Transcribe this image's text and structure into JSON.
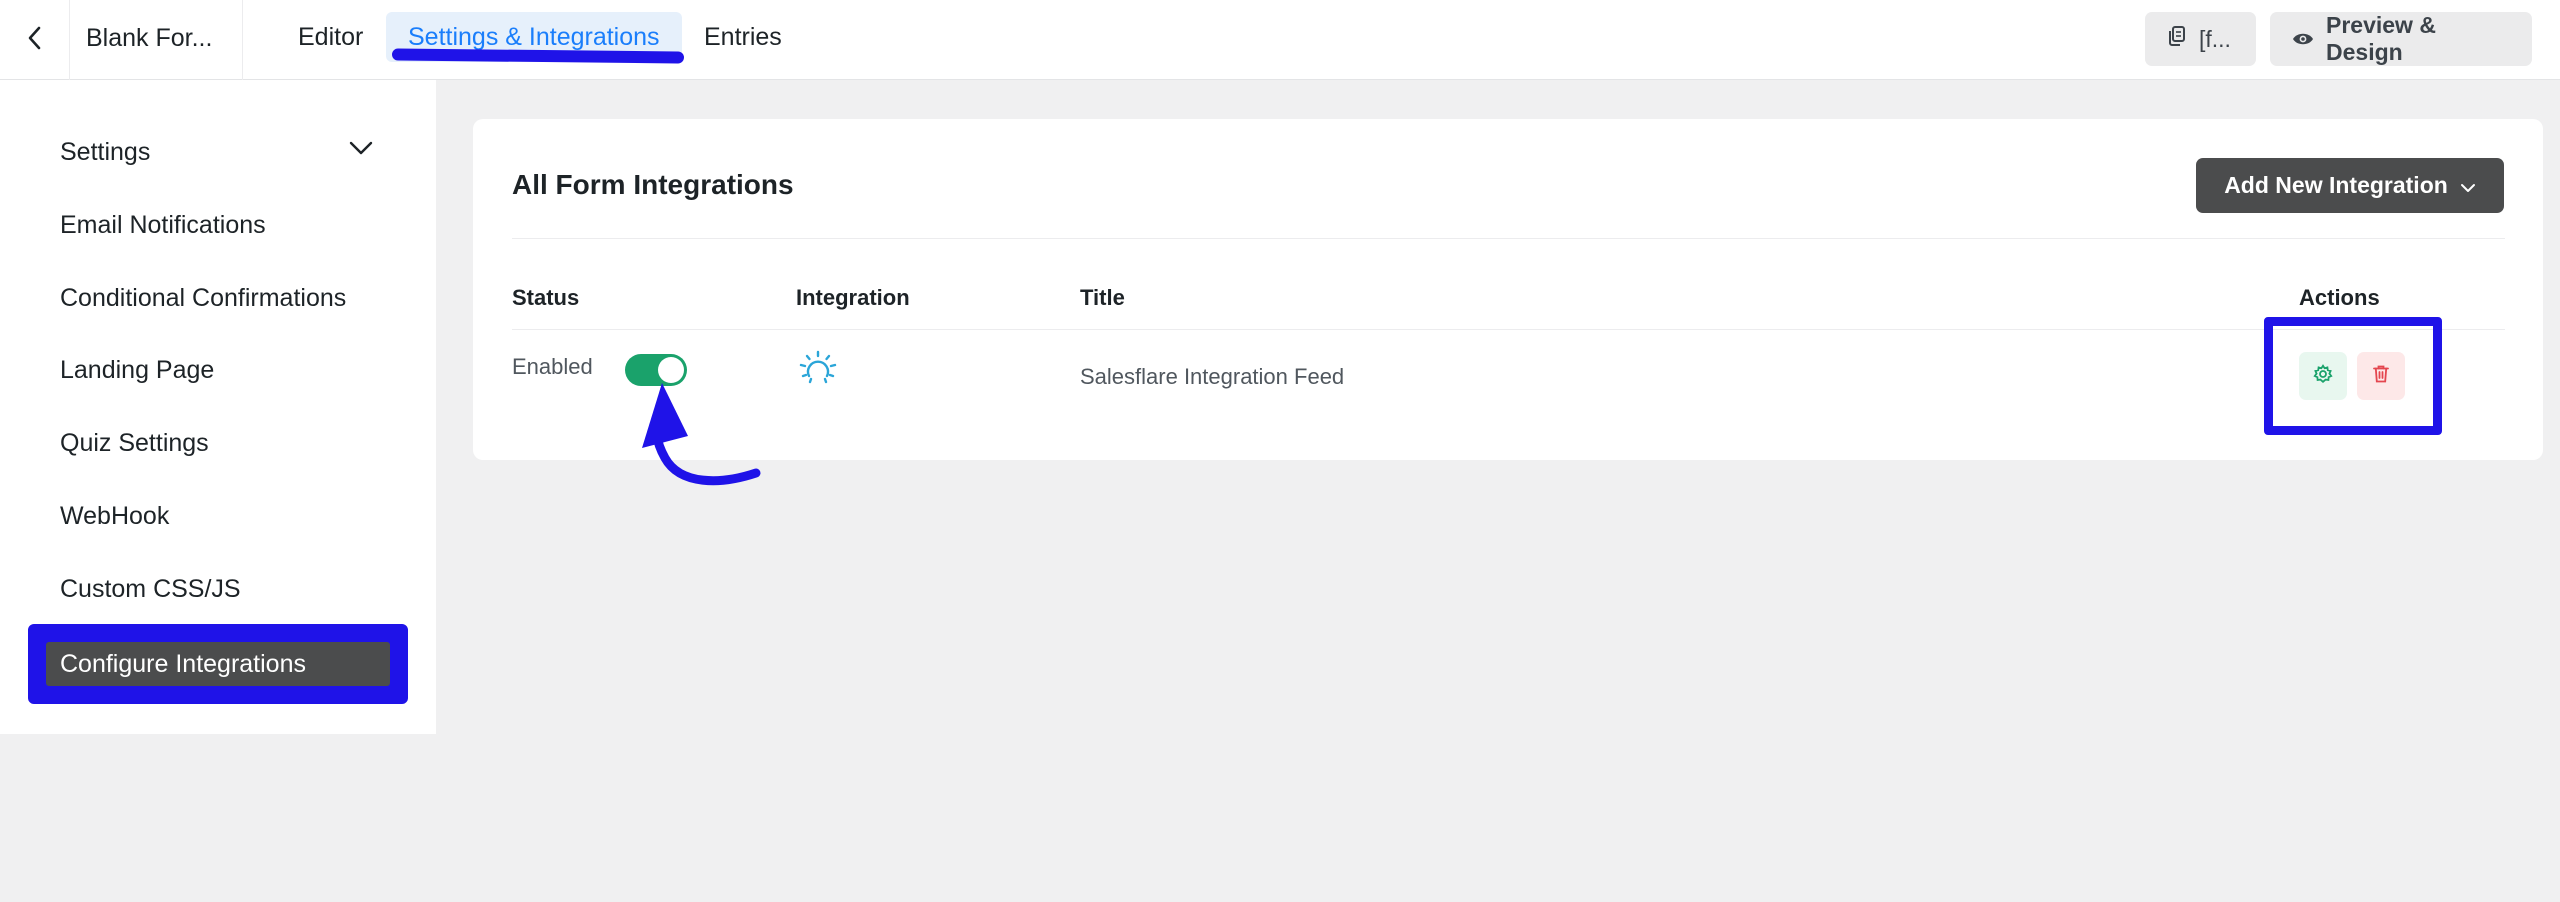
{
  "topbar": {
    "back_icon": "chevron-left-icon",
    "form_name": "Blank For...",
    "tabs": [
      {
        "label": "Editor",
        "active": false
      },
      {
        "label": "Settings & Integrations",
        "active": true
      },
      {
        "label": "Entries",
        "active": false
      }
    ],
    "shortcode_label": "[f...",
    "preview_label": "Preview & Design"
  },
  "sidebar": {
    "items": [
      {
        "label": "Settings"
      },
      {
        "label": "Email Notifications"
      },
      {
        "label": "Conditional Confirmations"
      },
      {
        "label": "Landing Page"
      },
      {
        "label": "Quiz Settings"
      },
      {
        "label": "WebHook"
      },
      {
        "label": "Custom CSS/JS"
      },
      {
        "label": "Configure Integrations",
        "active": true
      }
    ]
  },
  "main": {
    "title": "All Form Integrations",
    "add_button_label": "Add New Integration",
    "columns": [
      "Status",
      "Integration",
      "Title",
      "Actions"
    ],
    "rows": [
      {
        "status_text": "Enabled",
        "enabled": true,
        "integration_icon": "salesflare-logo-icon",
        "title": "Salesflare Integration Feed"
      }
    ]
  },
  "colors": {
    "accent": "#1a7efb",
    "toggle_on": "#1aa26b",
    "annotation": "#1f13e8",
    "dark_button": "#4b4c4d"
  }
}
